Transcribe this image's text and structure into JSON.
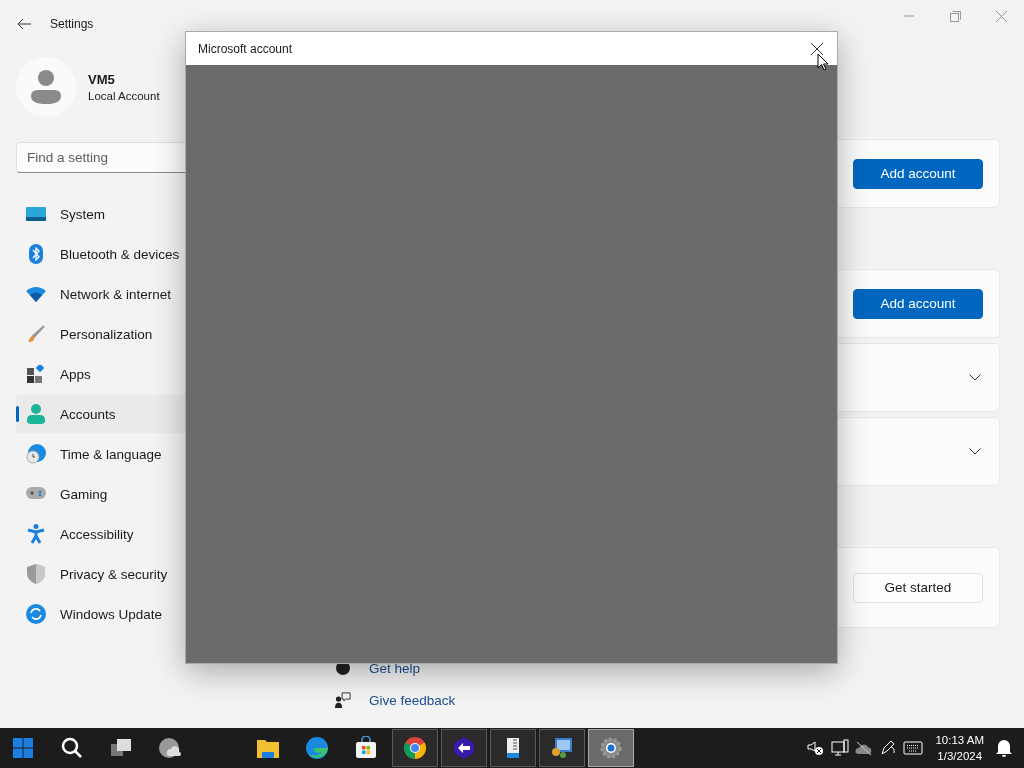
{
  "window": {
    "title": "Settings"
  },
  "user": {
    "name": "VM5",
    "account_type": "Local Account"
  },
  "search": {
    "placeholder": "Find a setting"
  },
  "nav": [
    {
      "label": "System",
      "selected": false
    },
    {
      "label": "Bluetooth & devices",
      "selected": false
    },
    {
      "label": "Network & internet",
      "selected": false
    },
    {
      "label": "Personalization",
      "selected": false
    },
    {
      "label": "Apps",
      "selected": false
    },
    {
      "label": "Accounts",
      "selected": true
    },
    {
      "label": "Time & language",
      "selected": false
    },
    {
      "label": "Gaming",
      "selected": false
    },
    {
      "label": "Accessibility",
      "selected": false
    },
    {
      "label": "Privacy & security",
      "selected": false
    },
    {
      "label": "Windows Update",
      "selected": false
    }
  ],
  "groups": [
    [
      {
        "kind": "button",
        "label": "Add account",
        "primary": true
      }
    ],
    [
      {
        "kind": "button",
        "label": "Add account",
        "primary": true
      },
      {
        "kind": "expander"
      },
      {
        "kind": "expander"
      }
    ],
    [
      {
        "kind": "button",
        "label": "Get started",
        "primary": false
      }
    ]
  ],
  "links": [
    {
      "label": "Get help"
    },
    {
      "label": "Give feedback"
    }
  ],
  "dialog": {
    "title": "Microsoft account"
  },
  "taskbar": {
    "apps": [
      {
        "open": false,
        "selected": false
      },
      {
        "open": false,
        "selected": false
      },
      {
        "open": false,
        "selected": false
      },
      {
        "open": false,
        "selected": false
      },
      {
        "open": false,
        "selected": false
      },
      {
        "open": false,
        "selected": false
      },
      {
        "open": false,
        "selected": false
      },
      {
        "open": true,
        "selected": false
      },
      {
        "open": true,
        "selected": false
      },
      {
        "open": true,
        "selected": false
      },
      {
        "open": true,
        "selected": false
      },
      {
        "open": true,
        "selected": true
      }
    ],
    "time": "10:13 AM",
    "date": "1/3/2024"
  }
}
